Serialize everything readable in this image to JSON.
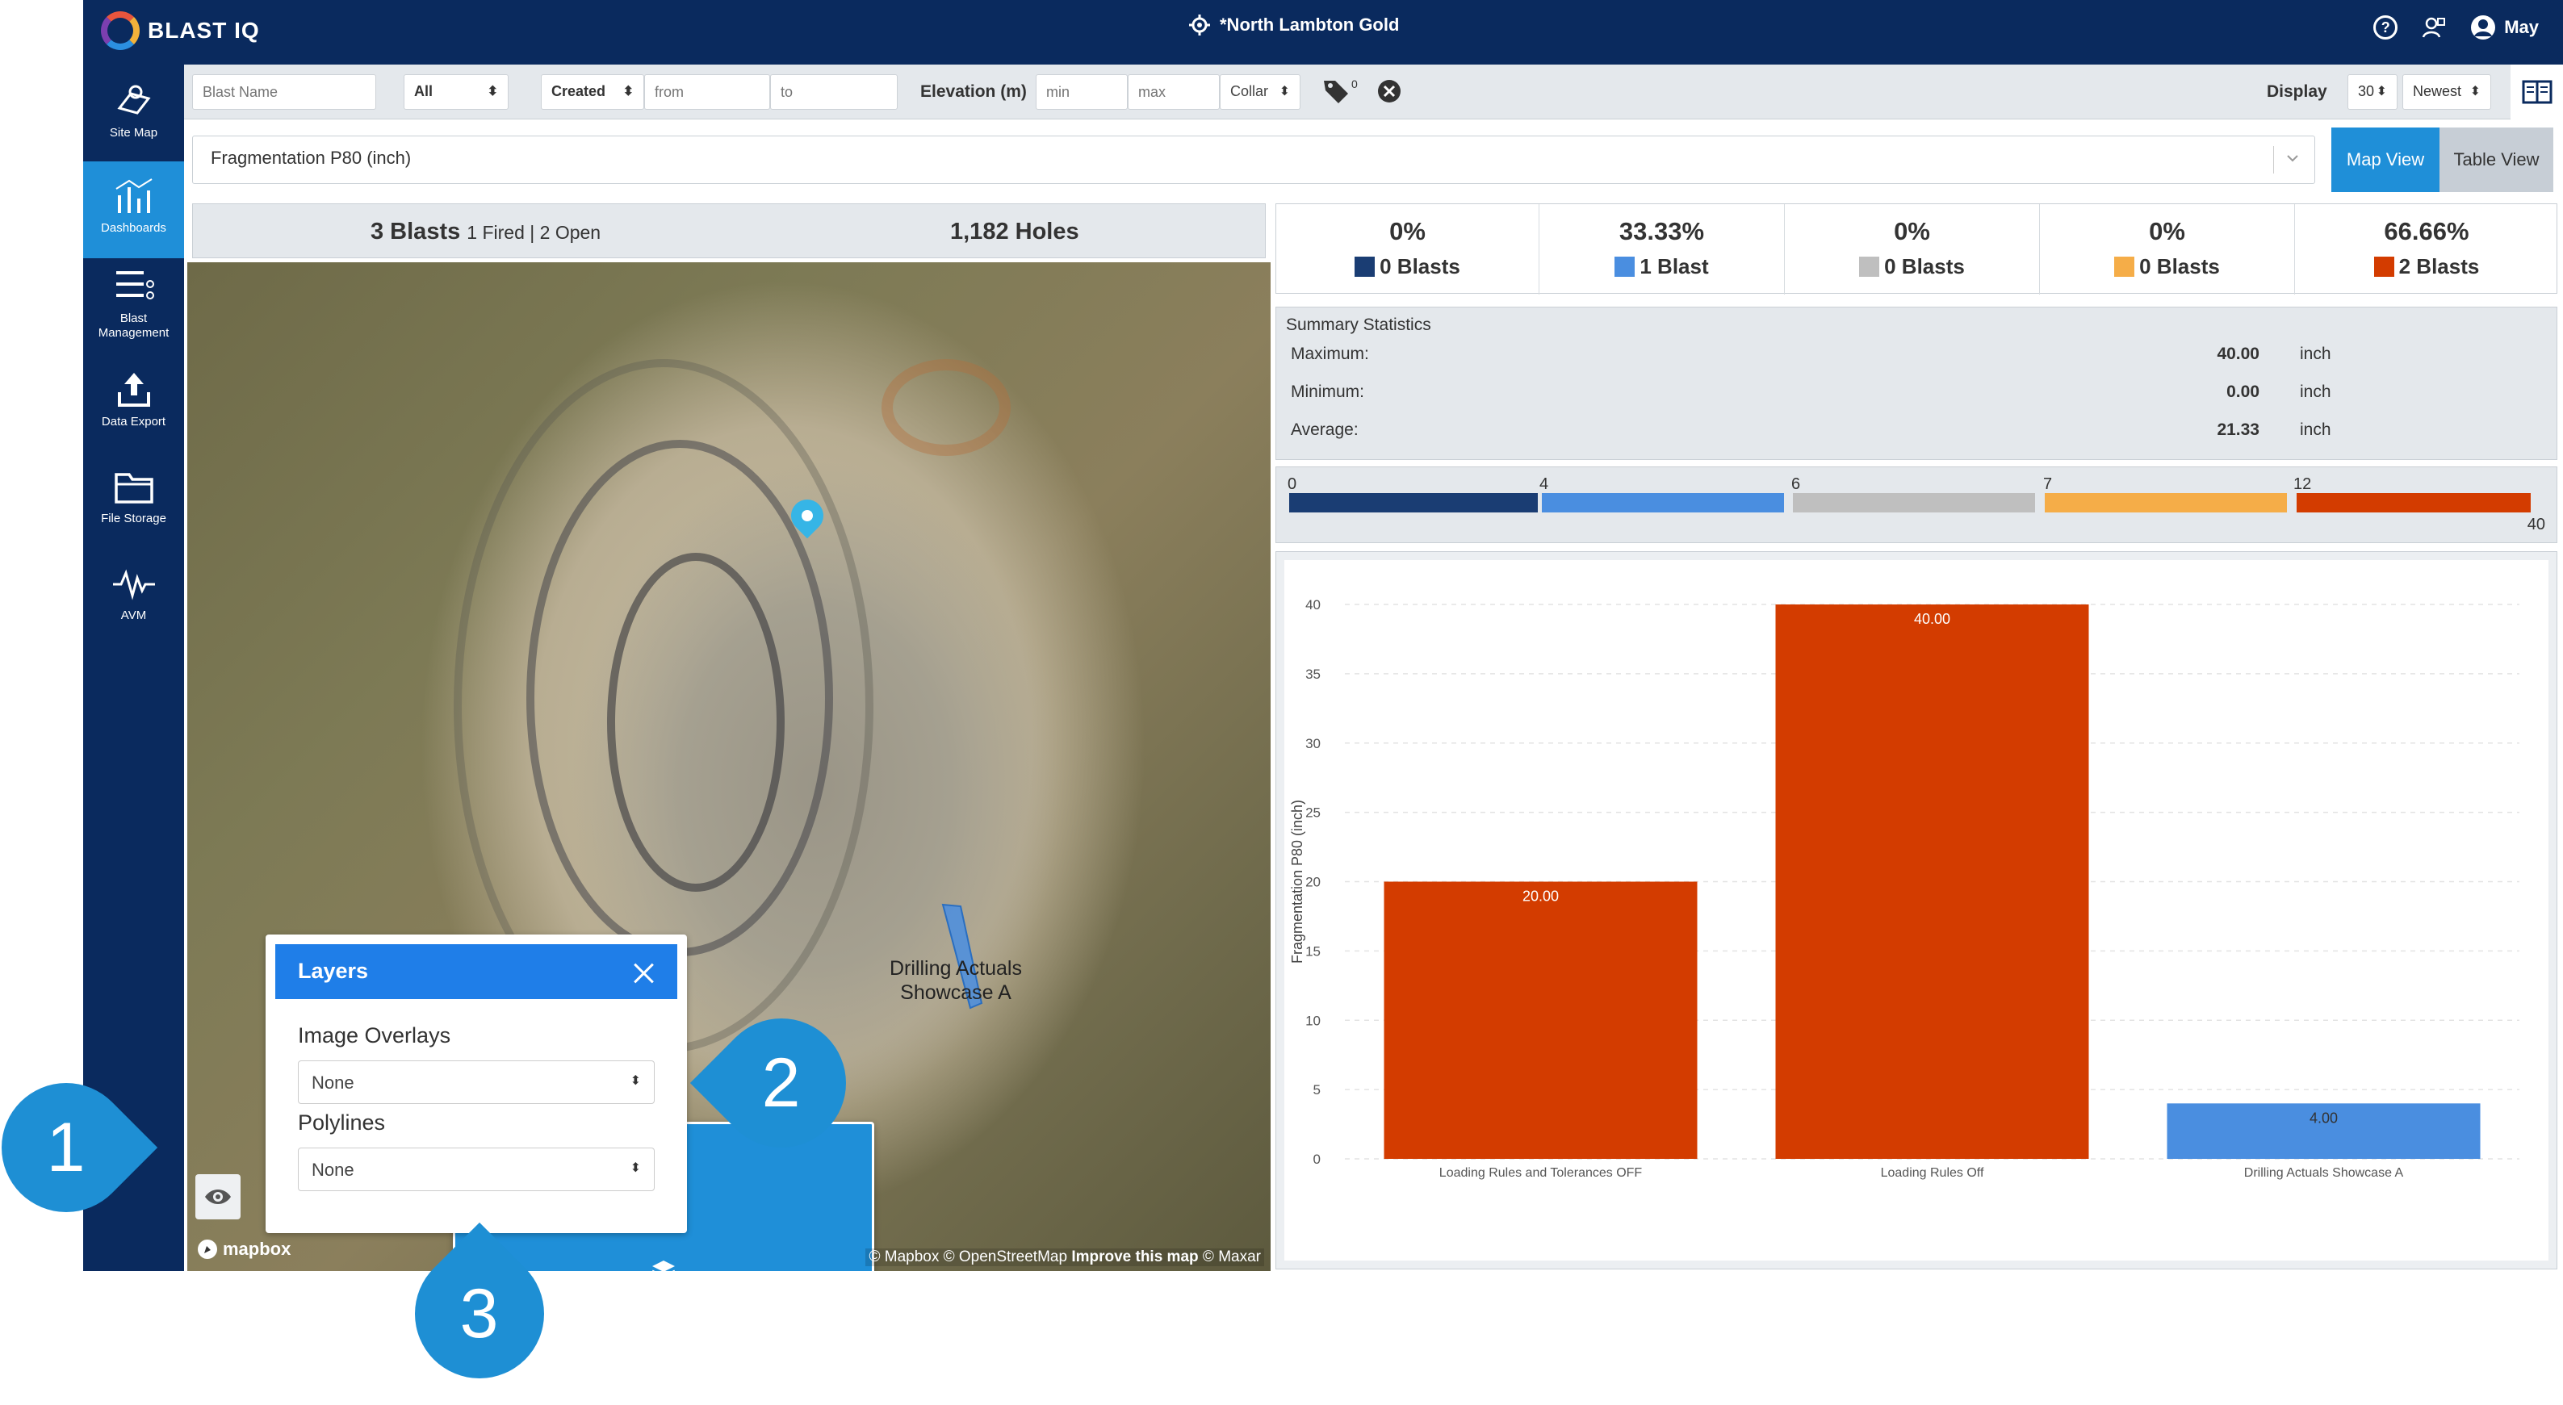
{
  "app": {
    "logo_text": "BLAST IQ",
    "site_name": "*North Lambton Gold",
    "user_name": "May"
  },
  "sidebar": {
    "items": [
      {
        "label": "Site Map"
      },
      {
        "label": "Dashboards"
      },
      {
        "label": "Blast Management"
      },
      {
        "label": "Data Export"
      },
      {
        "label": "File Storage"
      },
      {
        "label": "AVM"
      }
    ]
  },
  "filters": {
    "blast_name_placeholder": "Blast Name",
    "status_value": "All",
    "date_type_value": "Created",
    "from_placeholder": "from",
    "to_placeholder": "to",
    "elevation_label": "Elevation (m)",
    "min_placeholder": "min",
    "max_placeholder": "max",
    "elevation_ref_value": "Collar",
    "tag_count": "0",
    "display_label": "Display",
    "display_count_value": "30",
    "sort_value": "Newest"
  },
  "measure": {
    "selected": "Fragmentation P80 (inch)",
    "map_view_label": "Map View",
    "table_view_label": "Table View"
  },
  "blast_summary": {
    "blasts_label": "3 Blasts",
    "breakdown": "1 Fired | 2 Open",
    "holes_label": "1,182 Holes"
  },
  "map": {
    "polygon_label_line1": "Drilling Actuals",
    "polygon_label_line2": "Showcase A",
    "mapbox_text": "mapbox",
    "attribution": "© Mapbox © OpenStreetMap",
    "improve_text": "Improve this map",
    "maxar_text": "© Maxar"
  },
  "layers_panel": {
    "title": "Layers",
    "image_overlays_label": "Image Overlays",
    "image_overlays_value": "None",
    "polylines_label": "Polylines",
    "polylines_value": "None"
  },
  "callouts": [
    "1",
    "2",
    "3"
  ],
  "range_stats": [
    {
      "pct": "0%",
      "count": "0 Blasts",
      "color": "#1a3d73"
    },
    {
      "pct": "33.33%",
      "count": "1 Blast",
      "color": "#4a8ee0"
    },
    {
      "pct": "0%",
      "count": "0 Blasts",
      "color": "#bfbfbf"
    },
    {
      "pct": "0%",
      "count": "0 Blasts",
      "color": "#f5ad48"
    },
    {
      "pct": "66.66%",
      "count": "2 Blasts",
      "color": "#d33c00"
    }
  ],
  "summary_stats": {
    "title": "Summary Statistics",
    "rows": [
      {
        "label": "Maximum:",
        "value": "40.00",
        "unit": "inch"
      },
      {
        "label": "Minimum:",
        "value": "0.00",
        "unit": "inch"
      },
      {
        "label": "Average:",
        "value": "21.33",
        "unit": "inch"
      }
    ]
  },
  "scale": {
    "ticks": [
      "0",
      "4",
      "6",
      "7",
      "12"
    ],
    "max": "40"
  },
  "chart_data": {
    "type": "bar",
    "categories": [
      "Loading Rules and Tolerances OFF",
      "Loading Rules Off",
      "Drilling Actuals Showcase A"
    ],
    "values": [
      20,
      40,
      4
    ],
    "value_labels": [
      "20.00",
      "40.00",
      "4.00"
    ],
    "bar_colors": [
      "#d33c00",
      "#d33c00",
      "#4a8ee0"
    ],
    "ylabel": "Fragmentation P80 (inch)",
    "ylim": [
      0,
      40
    ],
    "yticks": [
      0,
      5,
      10,
      15,
      20,
      25,
      30,
      35,
      40
    ],
    "grid": true
  }
}
